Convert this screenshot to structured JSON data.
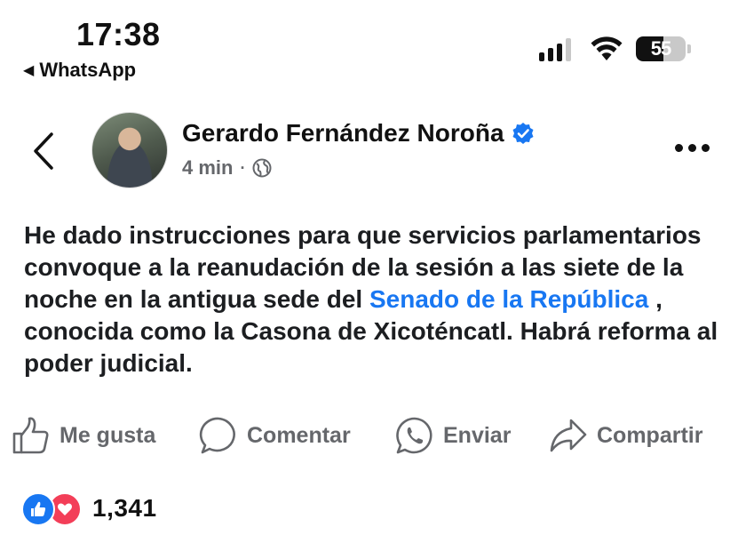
{
  "status_bar": {
    "time": "17:38",
    "back_app_label": "WhatsApp",
    "back_app_glyph": "◀",
    "battery_level": "55",
    "signal_bars_active": 3,
    "signal_bars_total": 4,
    "icons": [
      "signal-icon",
      "wifi-icon",
      "battery-icon"
    ]
  },
  "post": {
    "author": "Gerardo Fernández Noroña",
    "verified": true,
    "time_ago": "4 min",
    "separator": "·",
    "audience_icon": "globe-icon",
    "text_before_link": "He dado instrucciones para que servicios parlamentarios convoque a la reanudación de la sesión a las siete de la noche en la antigua sede del ",
    "link_text": "Senado de la República",
    "text_after_link": " , conocida como la Casona de Xicoténcatl. Habrá reforma al poder judicial."
  },
  "actions": {
    "like_label": "Me gusta",
    "comment_label": "Comentar",
    "send_label": "Enviar",
    "share_label": "Compartir"
  },
  "reactions": {
    "types": [
      "like",
      "love"
    ],
    "count": "1,341"
  },
  "colors": {
    "link": "#1877f2",
    "verified": "#1877f2",
    "muted": "#65676b",
    "love": "#f33e58"
  }
}
